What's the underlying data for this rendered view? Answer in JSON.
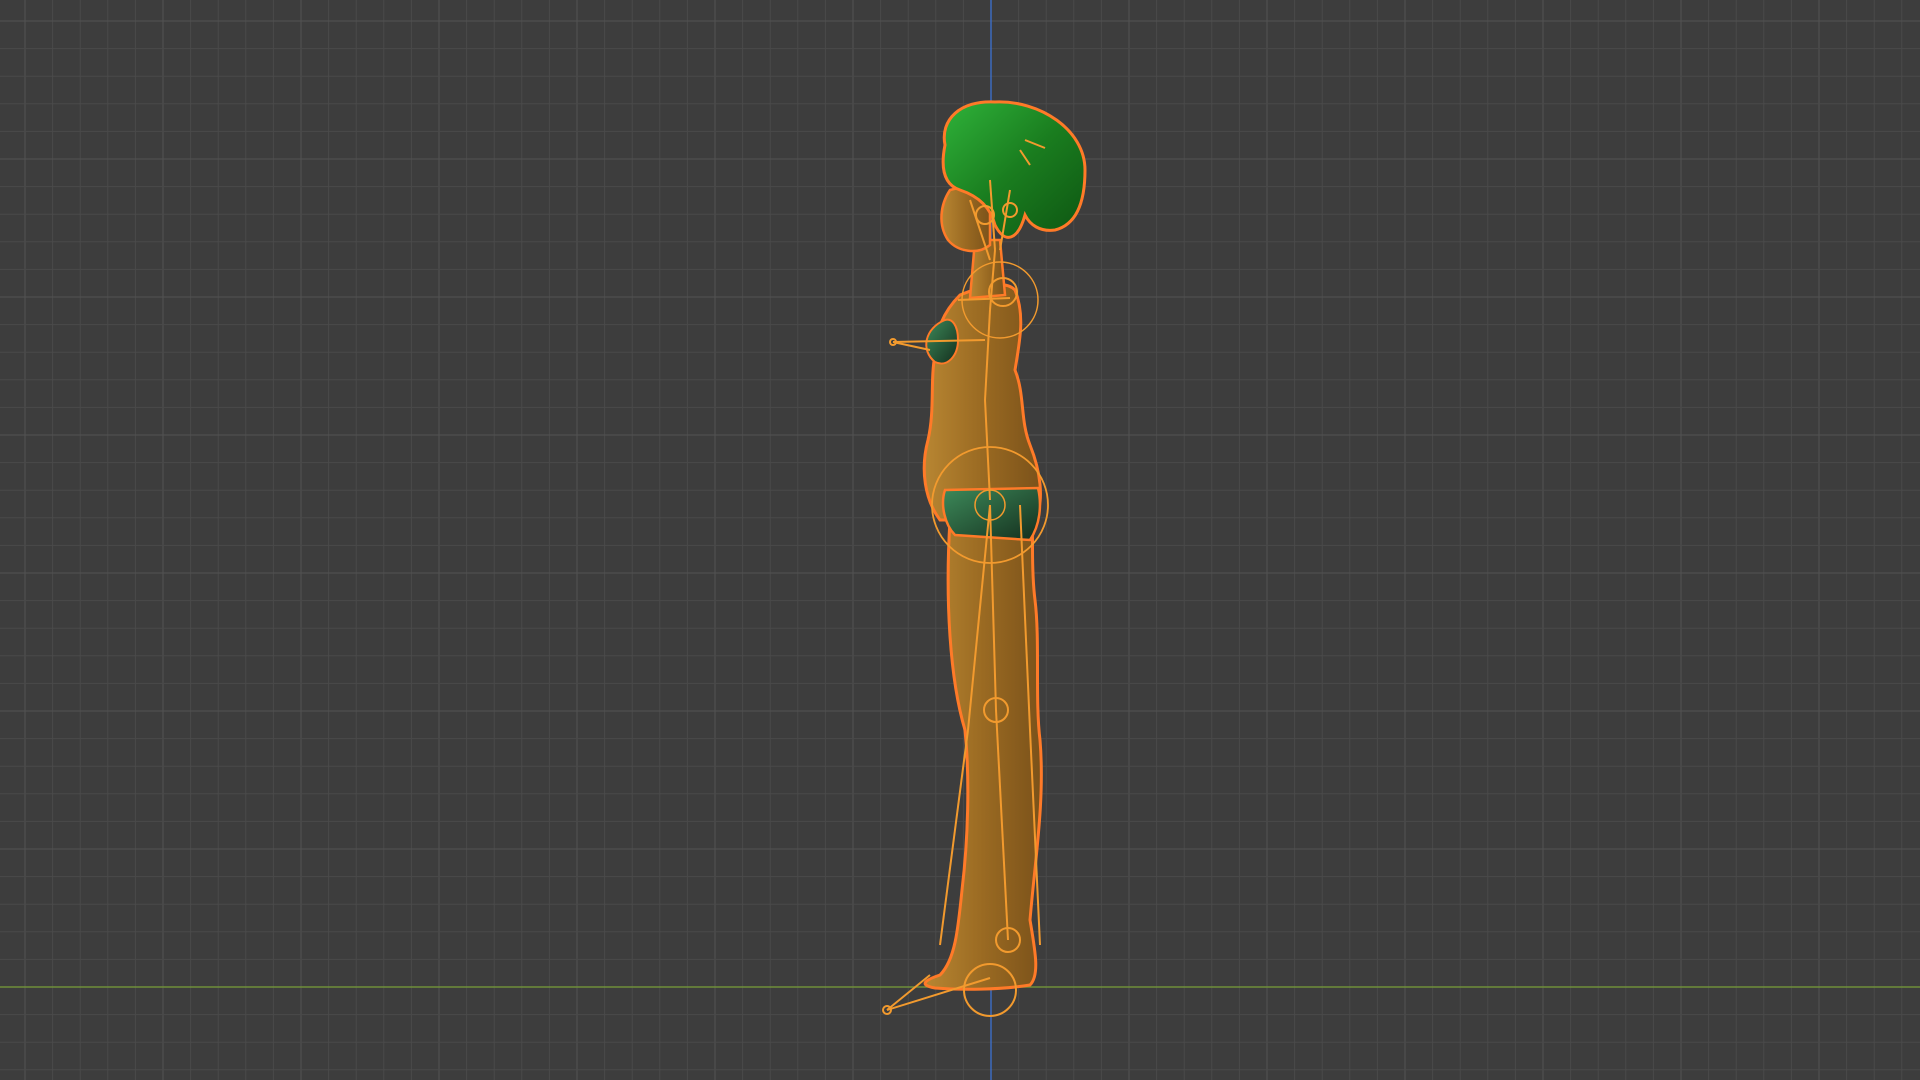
{
  "app": {
    "view": "right-orthographic",
    "mode": "object"
  },
  "viewport": {
    "background_color": "#3d3d3d",
    "grid_color": "#4a4a4a",
    "grid_major_color": "#525252",
    "ground_axis_color": "#6f8f3a",
    "vertical_axis_color": "#3d6bbf"
  },
  "scene": {
    "character": {
      "hair_color": "#1f8a1f",
      "skin_color": "#a8752a",
      "clothing_color": "#1e4a2e",
      "selection_outline_color": "#ff7a28",
      "armature_color": "#f29a2e"
    }
  },
  "icons": {
    "armature": "armature-bones",
    "mesh": "character-mesh"
  }
}
